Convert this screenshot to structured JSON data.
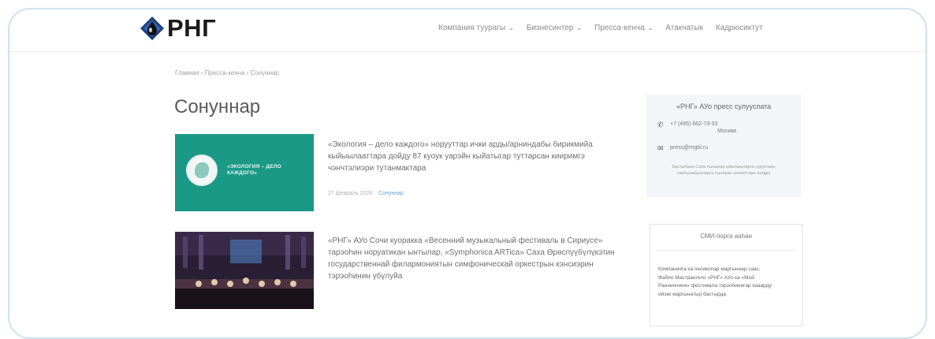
{
  "brand": {
    "logo_text": "РНГ",
    "logo_icon": "rng-drop-logo",
    "accent": "#1b1b1b"
  },
  "nav": {
    "items": [
      {
        "label": "Компания туурагы",
        "has_dropdown": true
      },
      {
        "label": "Бизнесинтер",
        "has_dropdown": true
      },
      {
        "label": "Пресса-кенча",
        "has_dropdown": true
      },
      {
        "label": "Атакчатык",
        "has_dropdown": false
      },
      {
        "label": "Кадрюсиктут",
        "has_dropdown": false
      }
    ],
    "chevron_glyph": "⌄"
  },
  "breadcrumb": "Главная › Пресса-кенча › Сонуннар",
  "page": {
    "title": "Сонуннар"
  },
  "news": [
    {
      "thumb_text": "«ЭКОЛОГИЯ – ДЕЛО КАЖДОГО»",
      "text": "«Экология – дело каждого» норууттар ички арды/арниндабы бирикмийа кыйыылааттара дойду 87 куоук уарэйн кыйатыгар туттарсан кииримгэ чэнчтэлиэри тутанмактара",
      "date": "27 февраль 2024",
      "tag": "Сонуннар",
      "thumb_color": "#1a9a86"
    },
    {
      "text": "«РНГ» АУо Сочи куоракка «Весенний музыкальный фестиваль в Сириусе» тарэоhин норуатикан ынтылар, «Symphonica ARTica» Саха Өрөспүүбүлүкэтин государственнай филармониятын симфоническай оркестрын кэнсиэрин тэрэоhинин үбүлуйа",
      "thumb_color": "#241a2e"
    }
  ],
  "press": {
    "title": "«РНГ» АУо пресс сулууспата",
    "phone": "+7 (495) 662-73-33",
    "city": "Москва",
    "email": "press@rngbl.ru",
    "note": "Бастыбаан Саха тылынан ыйытыыларга суруктаан сааhынабылларга тыллаах эппиэттэри кэлдиэ",
    "phone_icon": "phone-icon",
    "mail_icon": "mail-icon"
  },
  "smi": {
    "title": "СМИ-порга ааhан",
    "text": "Компанияга ка пеликопар маргыннар саас. Фабио Мастрангело «РНГ» АУо-ка «Мой Раннинчиня» фестивала тэрэоhинигар кааарду ийэкк маргынатыр бастырда"
  }
}
